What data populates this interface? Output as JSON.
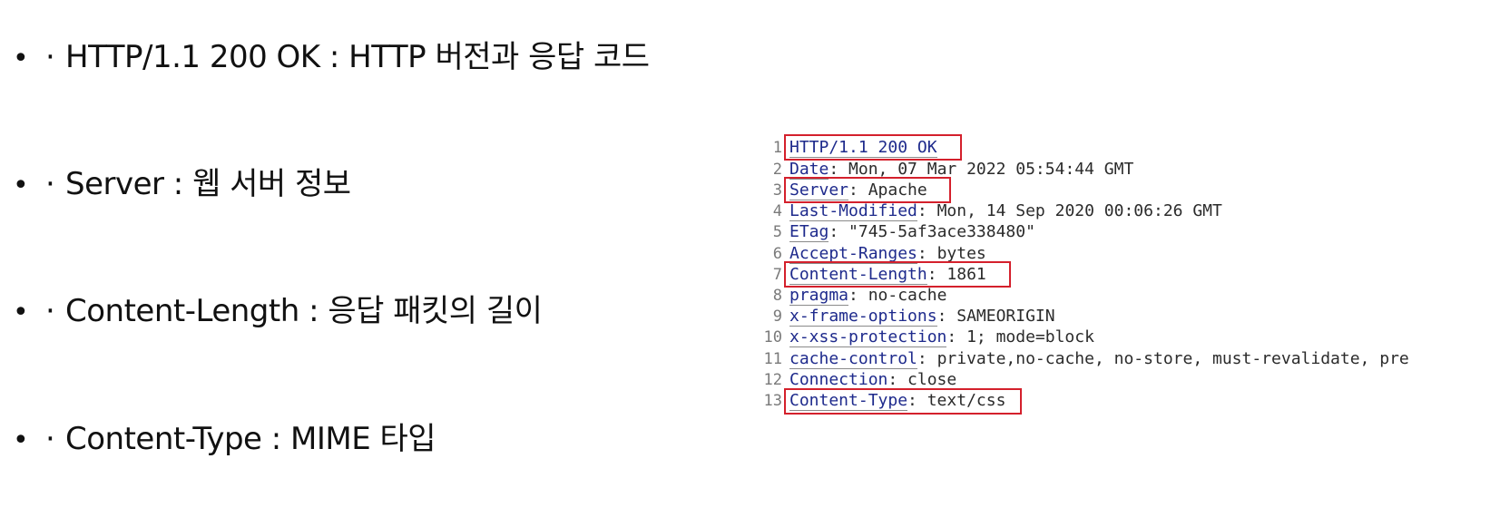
{
  "bullets": [
    {
      "marker": "•",
      "middot": "·",
      "text": "HTTP/1.1 200 OK : HTTP 버전과 응답 코드"
    },
    {
      "marker": "•",
      "middot": "·",
      "text": "Server : 웹 서버 정보"
    },
    {
      "marker": "•",
      "middot": "·",
      "text": "Content-Length : 응답 패킷의 길이"
    },
    {
      "marker": "•",
      "middot": "·",
      "text": "Content-Type : MIME 타입"
    }
  ],
  "response_lines": [
    {
      "num": "1",
      "key": "HTTP/1.1 200 OK",
      "value": ""
    },
    {
      "num": "2",
      "key": "Date",
      "value": ": Mon, 07 Mar 2022 05:54:44 GMT"
    },
    {
      "num": "3",
      "key": "Server",
      "value": ": Apache"
    },
    {
      "num": "4",
      "key": "Last-Modified",
      "value": ": Mon, 14 Sep 2020 00:06:26 GMT"
    },
    {
      "num": "5",
      "key": "ETag",
      "value": ": \"745-5af3ace338480\""
    },
    {
      "num": "6",
      "key": "Accept-Ranges",
      "value": ": bytes"
    },
    {
      "num": "7",
      "key": "Content-Length",
      "value": ": 1861"
    },
    {
      "num": "8",
      "key": "pragma",
      "value": ": no-cache"
    },
    {
      "num": "9",
      "key": "x-frame-options",
      "value": ": SAMEORIGIN"
    },
    {
      "num": "10",
      "key": "x-xss-protection",
      "value": ": 1; mode=block"
    },
    {
      "num": "11",
      "key": "cache-control",
      "value": ": private,no-cache, no-store, must-revalidate, pre"
    },
    {
      "num": "12",
      "key": "Connection",
      "value": ": close"
    },
    {
      "num": "13",
      "key": "Content-Type",
      "value": ": text/css"
    }
  ],
  "colors": {
    "highlight": "#d4202c",
    "header_key": "#1e2a8c"
  }
}
